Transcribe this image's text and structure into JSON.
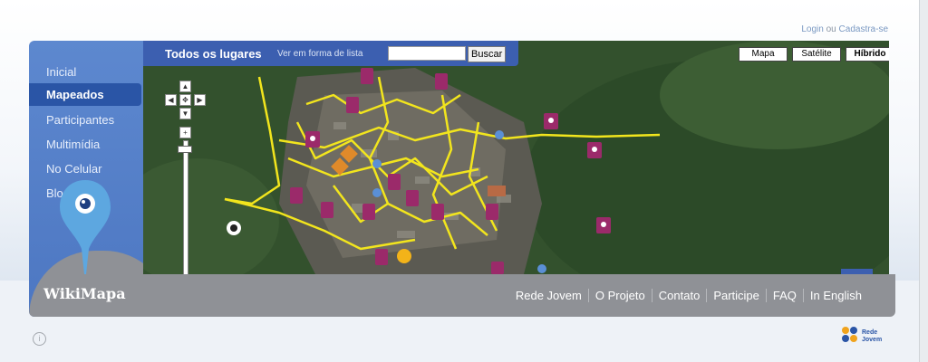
{
  "header": {
    "login": "Login",
    "or": " ou ",
    "signup": "Cadastra-se"
  },
  "sidebar": {
    "items": [
      {
        "label": "Inicial"
      },
      {
        "label": "Mapeados",
        "active": true
      },
      {
        "label": "Participantes"
      },
      {
        "label": "Multimídia"
      },
      {
        "label": "No Celular"
      },
      {
        "label": "Blog"
      }
    ],
    "logo": "WikiMapa"
  },
  "map": {
    "title": "Todos os lugares",
    "list_link": "Ver em forma de lista",
    "search_value": "",
    "search_button": "Buscar",
    "types": [
      {
        "label": "Mapa"
      },
      {
        "label": "Satélite"
      },
      {
        "label": "Híbrido",
        "active": true
      }
    ]
  },
  "footer": {
    "links": [
      "Rede Jovem",
      "O Projeto",
      "Contato",
      "Participe",
      "FAQ",
      "In English"
    ]
  },
  "partner": {
    "line1": "Rede",
    "line2": "Jovem"
  },
  "colors": {
    "brand": "#4d77c2",
    "active": "#2a55a6",
    "footer": "#8f9196",
    "marker": "#9b2a6a",
    "route": "#f2e51d"
  }
}
